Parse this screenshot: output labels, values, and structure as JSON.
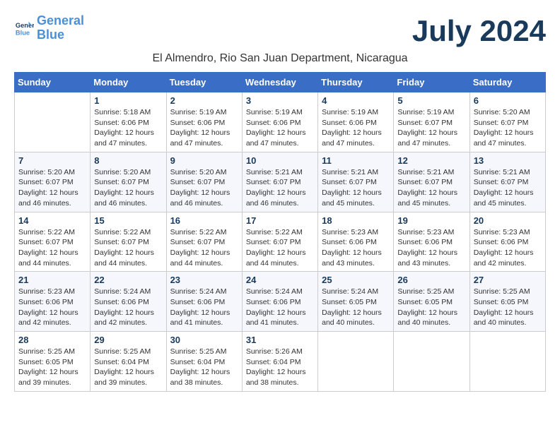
{
  "logo": {
    "line1": "General",
    "line2": "Blue"
  },
  "title": "July 2024",
  "location": "El Almendro, Rio San Juan Department, Nicaragua",
  "days_of_week": [
    "Sunday",
    "Monday",
    "Tuesday",
    "Wednesday",
    "Thursday",
    "Friday",
    "Saturday"
  ],
  "weeks": [
    [
      {
        "day": "",
        "info": ""
      },
      {
        "day": "1",
        "info": "Sunrise: 5:18 AM\nSunset: 6:06 PM\nDaylight: 12 hours\nand 47 minutes."
      },
      {
        "day": "2",
        "info": "Sunrise: 5:19 AM\nSunset: 6:06 PM\nDaylight: 12 hours\nand 47 minutes."
      },
      {
        "day": "3",
        "info": "Sunrise: 5:19 AM\nSunset: 6:06 PM\nDaylight: 12 hours\nand 47 minutes."
      },
      {
        "day": "4",
        "info": "Sunrise: 5:19 AM\nSunset: 6:06 PM\nDaylight: 12 hours\nand 47 minutes."
      },
      {
        "day": "5",
        "info": "Sunrise: 5:19 AM\nSunset: 6:07 PM\nDaylight: 12 hours\nand 47 minutes."
      },
      {
        "day": "6",
        "info": "Sunrise: 5:20 AM\nSunset: 6:07 PM\nDaylight: 12 hours\nand 47 minutes."
      }
    ],
    [
      {
        "day": "7",
        "info": "Sunrise: 5:20 AM\nSunset: 6:07 PM\nDaylight: 12 hours\nand 46 minutes."
      },
      {
        "day": "8",
        "info": "Sunrise: 5:20 AM\nSunset: 6:07 PM\nDaylight: 12 hours\nand 46 minutes."
      },
      {
        "day": "9",
        "info": "Sunrise: 5:20 AM\nSunset: 6:07 PM\nDaylight: 12 hours\nand 46 minutes."
      },
      {
        "day": "10",
        "info": "Sunrise: 5:21 AM\nSunset: 6:07 PM\nDaylight: 12 hours\nand 46 minutes."
      },
      {
        "day": "11",
        "info": "Sunrise: 5:21 AM\nSunset: 6:07 PM\nDaylight: 12 hours\nand 45 minutes."
      },
      {
        "day": "12",
        "info": "Sunrise: 5:21 AM\nSunset: 6:07 PM\nDaylight: 12 hours\nand 45 minutes."
      },
      {
        "day": "13",
        "info": "Sunrise: 5:21 AM\nSunset: 6:07 PM\nDaylight: 12 hours\nand 45 minutes."
      }
    ],
    [
      {
        "day": "14",
        "info": "Sunrise: 5:22 AM\nSunset: 6:07 PM\nDaylight: 12 hours\nand 44 minutes."
      },
      {
        "day": "15",
        "info": "Sunrise: 5:22 AM\nSunset: 6:07 PM\nDaylight: 12 hours\nand 44 minutes."
      },
      {
        "day": "16",
        "info": "Sunrise: 5:22 AM\nSunset: 6:07 PM\nDaylight: 12 hours\nand 44 minutes."
      },
      {
        "day": "17",
        "info": "Sunrise: 5:22 AM\nSunset: 6:07 PM\nDaylight: 12 hours\nand 44 minutes."
      },
      {
        "day": "18",
        "info": "Sunrise: 5:23 AM\nSunset: 6:06 PM\nDaylight: 12 hours\nand 43 minutes."
      },
      {
        "day": "19",
        "info": "Sunrise: 5:23 AM\nSunset: 6:06 PM\nDaylight: 12 hours\nand 43 minutes."
      },
      {
        "day": "20",
        "info": "Sunrise: 5:23 AM\nSunset: 6:06 PM\nDaylight: 12 hours\nand 42 minutes."
      }
    ],
    [
      {
        "day": "21",
        "info": "Sunrise: 5:23 AM\nSunset: 6:06 PM\nDaylight: 12 hours\nand 42 minutes."
      },
      {
        "day": "22",
        "info": "Sunrise: 5:24 AM\nSunset: 6:06 PM\nDaylight: 12 hours\nand 42 minutes."
      },
      {
        "day": "23",
        "info": "Sunrise: 5:24 AM\nSunset: 6:06 PM\nDaylight: 12 hours\nand 41 minutes."
      },
      {
        "day": "24",
        "info": "Sunrise: 5:24 AM\nSunset: 6:06 PM\nDaylight: 12 hours\nand 41 minutes."
      },
      {
        "day": "25",
        "info": "Sunrise: 5:24 AM\nSunset: 6:05 PM\nDaylight: 12 hours\nand 40 minutes."
      },
      {
        "day": "26",
        "info": "Sunrise: 5:25 AM\nSunset: 6:05 PM\nDaylight: 12 hours\nand 40 minutes."
      },
      {
        "day": "27",
        "info": "Sunrise: 5:25 AM\nSunset: 6:05 PM\nDaylight: 12 hours\nand 40 minutes."
      }
    ],
    [
      {
        "day": "28",
        "info": "Sunrise: 5:25 AM\nSunset: 6:05 PM\nDaylight: 12 hours\nand 39 minutes."
      },
      {
        "day": "29",
        "info": "Sunrise: 5:25 AM\nSunset: 6:04 PM\nDaylight: 12 hours\nand 39 minutes."
      },
      {
        "day": "30",
        "info": "Sunrise: 5:25 AM\nSunset: 6:04 PM\nDaylight: 12 hours\nand 38 minutes."
      },
      {
        "day": "31",
        "info": "Sunrise: 5:26 AM\nSunset: 6:04 PM\nDaylight: 12 hours\nand 38 minutes."
      },
      {
        "day": "",
        "info": ""
      },
      {
        "day": "",
        "info": ""
      },
      {
        "day": "",
        "info": ""
      }
    ]
  ]
}
